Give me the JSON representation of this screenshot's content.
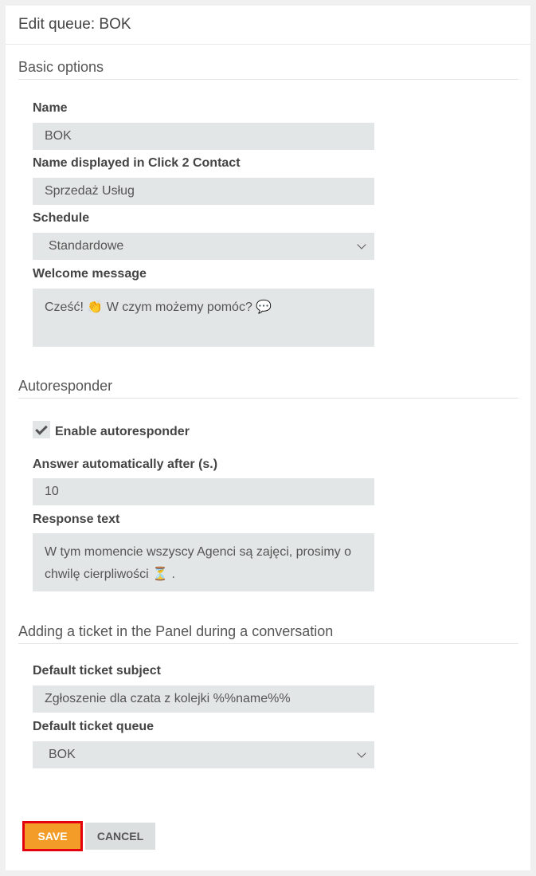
{
  "header": {
    "title": "Edit queue: BOK"
  },
  "basic": {
    "section_title": "Basic options",
    "name_label": "Name",
    "name_value": "BOK",
    "display_label": "Name displayed in Click 2 Contact",
    "display_value": "Sprzedaż Usług",
    "schedule_label": "Schedule",
    "schedule_value": "Standardowe",
    "welcome_label": "Welcome message",
    "welcome_value": "Cześć! 👏 W czym możemy pomóc? 💬"
  },
  "autoresponder": {
    "section_title": "Autoresponder",
    "enable_label": "Enable autoresponder",
    "enabled": true,
    "after_label": "Answer automatically after (s.)",
    "after_value": "10",
    "response_label": "Response text",
    "response_value": "W tym momencie wszyscy Agenci są zajęci, prosimy o chwilę cierpliwości ⏳ ."
  },
  "ticket": {
    "section_title": "Adding a ticket in the Panel during a conversation",
    "subject_label": "Default ticket subject",
    "subject_value": "Zgłoszenie dla czata z kolejki %%name%%",
    "queue_label": "Default ticket queue",
    "queue_value": "BOK"
  },
  "buttons": {
    "save": "SAVE",
    "cancel": "CANCEL"
  },
  "colors": {
    "accent": "#f39c27",
    "highlight": "#e3000f",
    "field_bg": "#e3e6e6"
  }
}
